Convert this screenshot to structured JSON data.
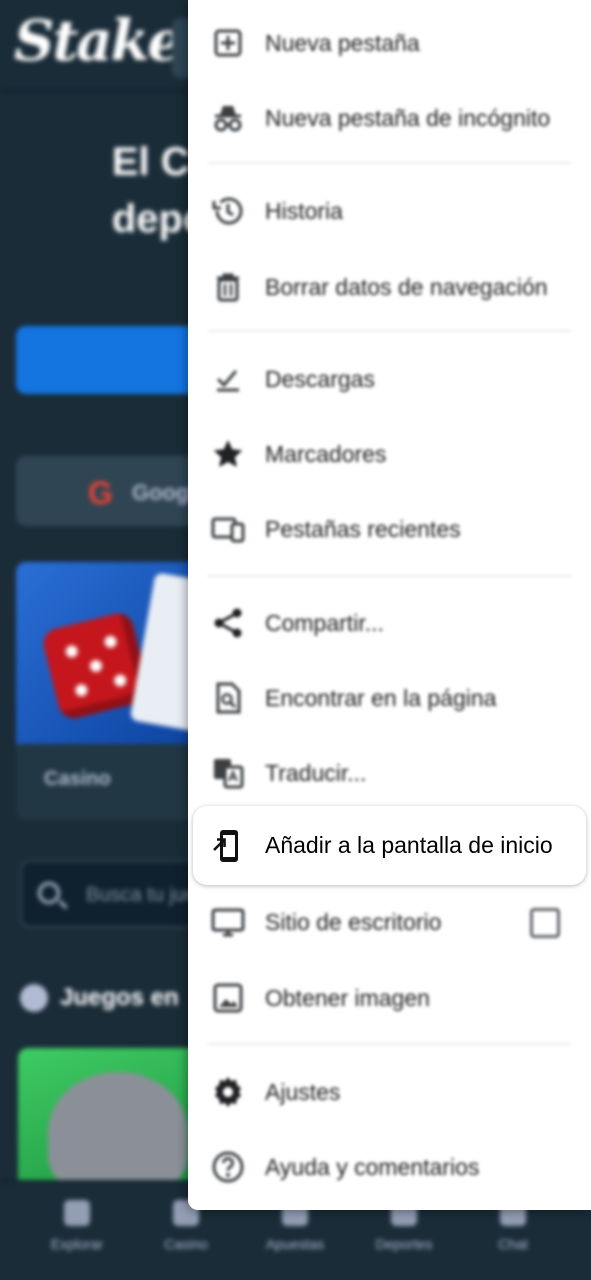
{
  "site": {
    "logo": "Stake",
    "hero_title": "El Casino deportivo",
    "google_button": "Google",
    "card_label": "Casino",
    "search_placeholder": "Busca tu juego",
    "section_title": "Juegos en",
    "bottom_nav": [
      "Explorar",
      "Casino",
      "Apuestas",
      "Deportes",
      "Chat"
    ]
  },
  "menu": {
    "items": [
      {
        "label": "Nueva pestaña",
        "icon": "new-tab-icon"
      },
      {
        "label": "Nueva pestaña de incógnito",
        "icon": "incognito-icon"
      },
      {
        "label": "Historia",
        "icon": "history-icon"
      },
      {
        "label": "Borrar datos de navegación",
        "icon": "trash-icon"
      },
      {
        "label": "Descargas",
        "icon": "download-icon"
      },
      {
        "label": "Marcadores",
        "icon": "star-icon"
      },
      {
        "label": "Pestañas recientes",
        "icon": "devices-icon"
      },
      {
        "label": "Compartir...",
        "icon": "share-icon"
      },
      {
        "label": "Encontrar en la página",
        "icon": "find-in-page-icon"
      },
      {
        "label": "Traducir...",
        "icon": "translate-icon"
      },
      {
        "label": "Sitio de escritorio",
        "icon": "desktop-icon"
      },
      {
        "label": "Obtener imagen",
        "icon": "image-icon"
      },
      {
        "label": "Ajustes",
        "icon": "settings-icon"
      },
      {
        "label": "Ayuda y comentarios",
        "icon": "help-icon"
      }
    ],
    "highlighted": {
      "label": "Añadir a la pantalla de inicio",
      "icon": "add-to-home-screen-icon"
    }
  }
}
